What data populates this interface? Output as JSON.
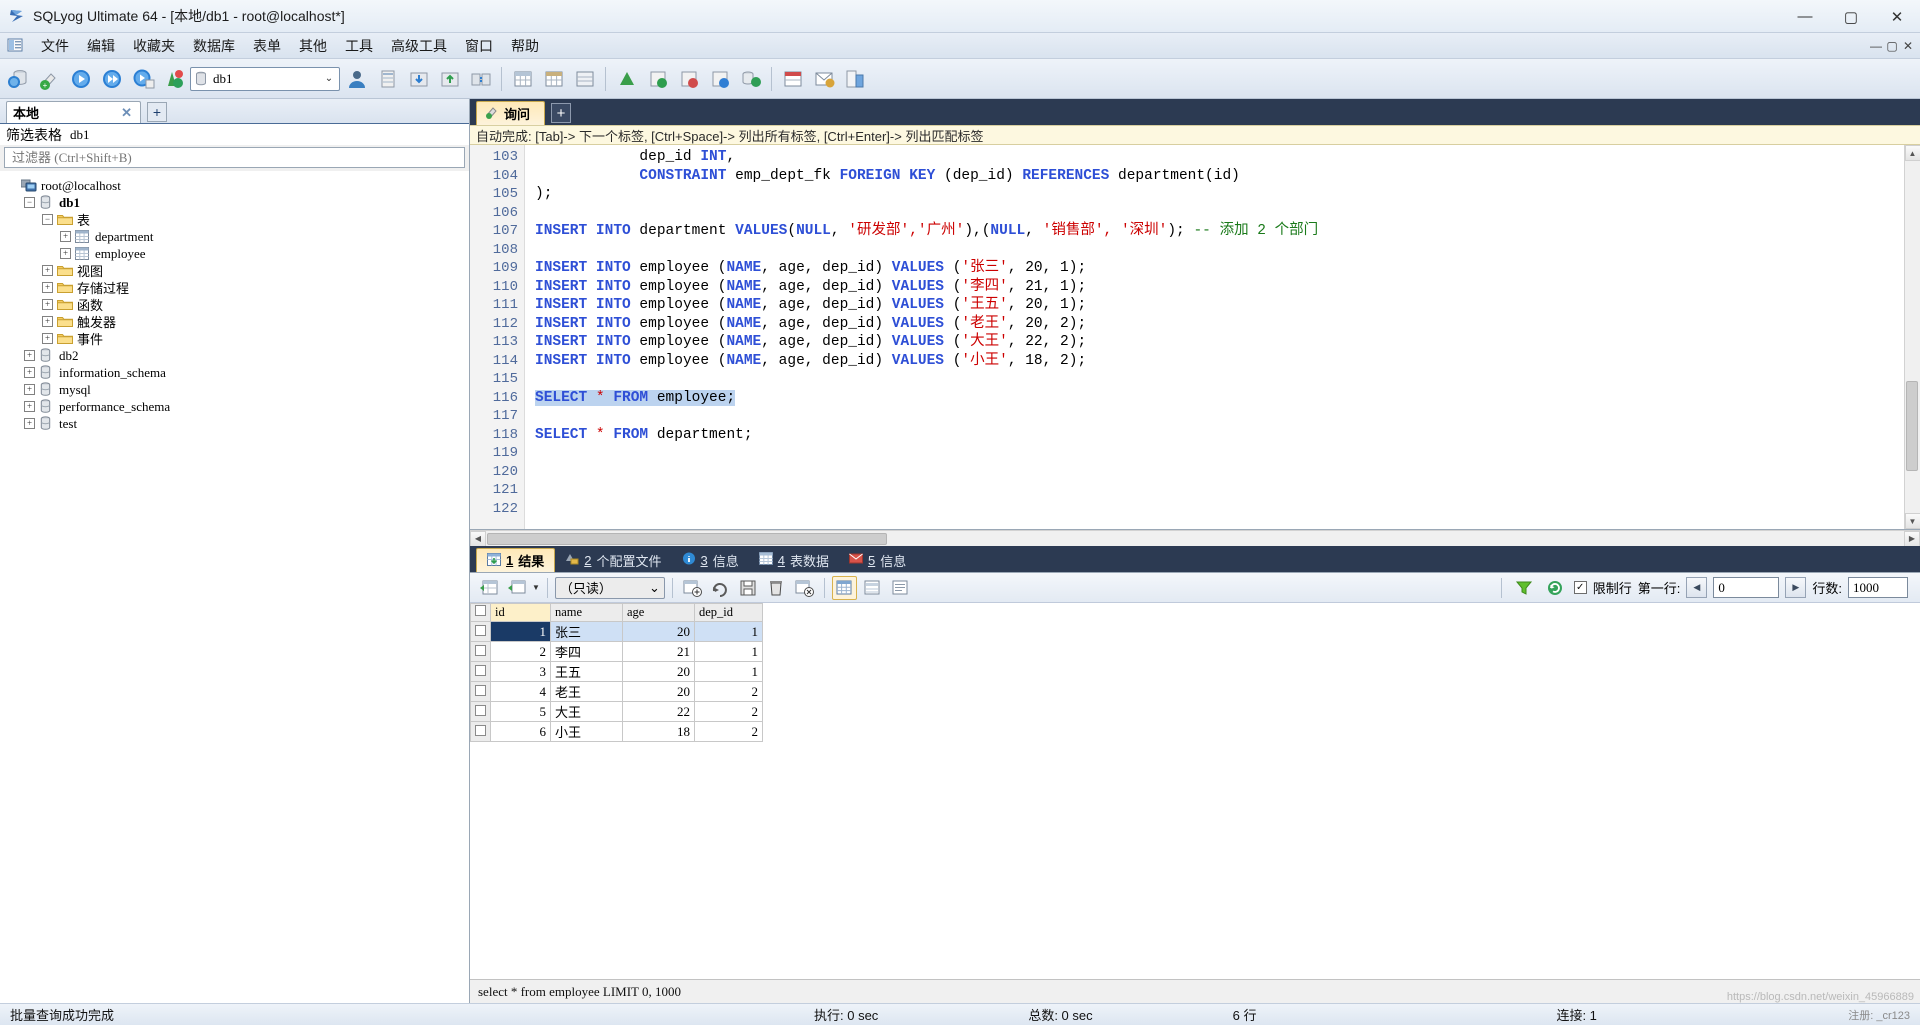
{
  "window": {
    "title": "SQLyog Ultimate 64 - [本地/db1 - root@localhost*]",
    "icon": "sqlyog-logo-icon",
    "controls": {
      "minimize": "—",
      "maximize": "▢",
      "close": "✕"
    }
  },
  "menubar": {
    "items": [
      "文件",
      "编辑",
      "收藏夹",
      "数据库",
      "表单",
      "其他",
      "工具",
      "高级工具",
      "窗口",
      "帮助"
    ],
    "right_buttons": [
      "—",
      "▢",
      "✕"
    ]
  },
  "toolbar": {
    "database_selector": {
      "value": "db1",
      "icon": "database-icon",
      "arrow": "⌄"
    }
  },
  "left_panel": {
    "connection_tab": {
      "label": "本地",
      "close": "✕"
    },
    "add_tab_label": "+",
    "filter_header": {
      "label": "筛选表格",
      "db": "db1"
    },
    "filter_input": {
      "value": "",
      "placeholder": "过滤器 (Ctrl+Shift+B)"
    },
    "tree": [
      {
        "label": "root@localhost",
        "icon": "host-icon",
        "depth": 0,
        "expander": "",
        "bold": false,
        "cn": false
      },
      {
        "label": "db1",
        "icon": "database-icon",
        "depth": 1,
        "expander": "−",
        "bold": true,
        "cn": false
      },
      {
        "label": "表",
        "icon": "folder-icon",
        "depth": 2,
        "expander": "−",
        "bold": false,
        "cn": true
      },
      {
        "label": "department",
        "icon": "table-icon",
        "depth": 3,
        "expander": "+",
        "bold": false,
        "cn": false
      },
      {
        "label": "employee",
        "icon": "table-icon",
        "depth": 3,
        "expander": "+",
        "bold": false,
        "cn": false
      },
      {
        "label": "视图",
        "icon": "folder-icon",
        "depth": 2,
        "expander": "+",
        "bold": false,
        "cn": true
      },
      {
        "label": "存储过程",
        "icon": "folder-icon",
        "depth": 2,
        "expander": "+",
        "bold": false,
        "cn": true
      },
      {
        "label": "函数",
        "icon": "folder-icon",
        "depth": 2,
        "expander": "+",
        "bold": false,
        "cn": true
      },
      {
        "label": "触发器",
        "icon": "folder-icon",
        "depth": 2,
        "expander": "+",
        "bold": false,
        "cn": true
      },
      {
        "label": "事件",
        "icon": "folder-icon",
        "depth": 2,
        "expander": "+",
        "bold": false,
        "cn": true
      },
      {
        "label": "db2",
        "icon": "database-icon",
        "depth": 1,
        "expander": "+",
        "bold": false,
        "cn": false
      },
      {
        "label": "information_schema",
        "icon": "database-icon",
        "depth": 1,
        "expander": "+",
        "bold": false,
        "cn": false
      },
      {
        "label": "mysql",
        "icon": "database-icon",
        "depth": 1,
        "expander": "+",
        "bold": false,
        "cn": false
      },
      {
        "label": "performance_schema",
        "icon": "database-icon",
        "depth": 1,
        "expander": "+",
        "bold": false,
        "cn": false
      },
      {
        "label": "test",
        "icon": "database-icon",
        "depth": 1,
        "expander": "+",
        "bold": false,
        "cn": false
      }
    ]
  },
  "editor": {
    "tab": {
      "label": "询问",
      "icon": "query-icon"
    },
    "add_tab_label": "+",
    "hint": "自动完成: [Tab]-> 下一个标签, [Ctrl+Space]-> 列出所有标签, [Ctrl+Enter]-> 列出匹配标签",
    "first_line_number": 103,
    "lines": [
      {
        "n": 103,
        "segments": [
          {
            "t": "            dep_id ",
            "c": "plain"
          },
          {
            "t": "INT",
            "c": "kw"
          },
          {
            "t": ",",
            "c": "plain"
          }
        ]
      },
      {
        "n": 104,
        "segments": [
          {
            "t": "            ",
            "c": "plain"
          },
          {
            "t": "CONSTRAINT",
            "c": "kw"
          },
          {
            "t": " emp_dept_fk ",
            "c": "plain"
          },
          {
            "t": "FOREIGN",
            "c": "kw"
          },
          {
            "t": " ",
            "c": "plain"
          },
          {
            "t": "KEY",
            "c": "kw"
          },
          {
            "t": " (dep_id) ",
            "c": "plain"
          },
          {
            "t": "REFERENCES",
            "c": "kw"
          },
          {
            "t": " department(id)",
            "c": "plain"
          }
        ]
      },
      {
        "n": 105,
        "segments": [
          {
            "t": ");",
            "c": "plain"
          }
        ]
      },
      {
        "n": 106,
        "segments": [
          {
            "t": "",
            "c": "plain"
          }
        ]
      },
      {
        "n": 107,
        "segments": [
          {
            "t": "INSERT",
            "c": "kw"
          },
          {
            "t": " ",
            "c": "plain"
          },
          {
            "t": "INTO",
            "c": "kw"
          },
          {
            "t": " department ",
            "c": "plain"
          },
          {
            "t": "VALUES",
            "c": "kw"
          },
          {
            "t": "(",
            "c": "plain"
          },
          {
            "t": "NULL",
            "c": "kw"
          },
          {
            "t": ", ",
            "c": "plain"
          },
          {
            "t": "'研发部','广州'",
            "c": "str"
          },
          {
            "t": "),(",
            "c": "plain"
          },
          {
            "t": "NULL",
            "c": "kw"
          },
          {
            "t": ", ",
            "c": "plain"
          },
          {
            "t": "'销售部', '深圳'",
            "c": "str"
          },
          {
            "t": "); ",
            "c": "plain"
          },
          {
            "t": "-- 添加 2 个部门",
            "c": "cmt"
          }
        ]
      },
      {
        "n": 108,
        "segments": [
          {
            "t": "",
            "c": "plain"
          }
        ]
      },
      {
        "n": 109,
        "segments": [
          {
            "t": "INSERT",
            "c": "kw"
          },
          {
            "t": " ",
            "c": "plain"
          },
          {
            "t": "INTO",
            "c": "kw"
          },
          {
            "t": " employee (",
            "c": "plain"
          },
          {
            "t": "NAME",
            "c": "kw"
          },
          {
            "t": ", age, dep_id) ",
            "c": "plain"
          },
          {
            "t": "VALUES",
            "c": "kw"
          },
          {
            "t": " (",
            "c": "plain"
          },
          {
            "t": "'张三'",
            "c": "str"
          },
          {
            "t": ", 20, 1);",
            "c": "plain"
          }
        ]
      },
      {
        "n": 110,
        "segments": [
          {
            "t": "INSERT",
            "c": "kw"
          },
          {
            "t": " ",
            "c": "plain"
          },
          {
            "t": "INTO",
            "c": "kw"
          },
          {
            "t": " employee (",
            "c": "plain"
          },
          {
            "t": "NAME",
            "c": "kw"
          },
          {
            "t": ", age, dep_id) ",
            "c": "plain"
          },
          {
            "t": "VALUES",
            "c": "kw"
          },
          {
            "t": " (",
            "c": "plain"
          },
          {
            "t": "'李四'",
            "c": "str"
          },
          {
            "t": ", 21, 1);",
            "c": "plain"
          }
        ]
      },
      {
        "n": 111,
        "segments": [
          {
            "t": "INSERT",
            "c": "kw"
          },
          {
            "t": " ",
            "c": "plain"
          },
          {
            "t": "INTO",
            "c": "kw"
          },
          {
            "t": " employee (",
            "c": "plain"
          },
          {
            "t": "NAME",
            "c": "kw"
          },
          {
            "t": ", age, dep_id) ",
            "c": "plain"
          },
          {
            "t": "VALUES",
            "c": "kw"
          },
          {
            "t": " (",
            "c": "plain"
          },
          {
            "t": "'王五'",
            "c": "str"
          },
          {
            "t": ", 20, 1);",
            "c": "plain"
          }
        ]
      },
      {
        "n": 112,
        "segments": [
          {
            "t": "INSERT",
            "c": "kw"
          },
          {
            "t": " ",
            "c": "plain"
          },
          {
            "t": "INTO",
            "c": "kw"
          },
          {
            "t": " employee (",
            "c": "plain"
          },
          {
            "t": "NAME",
            "c": "kw"
          },
          {
            "t": ", age, dep_id) ",
            "c": "plain"
          },
          {
            "t": "VALUES",
            "c": "kw"
          },
          {
            "t": " (",
            "c": "plain"
          },
          {
            "t": "'老王'",
            "c": "str"
          },
          {
            "t": ", 20, 2);",
            "c": "plain"
          }
        ]
      },
      {
        "n": 113,
        "segments": [
          {
            "t": "INSERT",
            "c": "kw"
          },
          {
            "t": " ",
            "c": "plain"
          },
          {
            "t": "INTO",
            "c": "kw"
          },
          {
            "t": " employee (",
            "c": "plain"
          },
          {
            "t": "NAME",
            "c": "kw"
          },
          {
            "t": ", age, dep_id) ",
            "c": "plain"
          },
          {
            "t": "VALUES",
            "c": "kw"
          },
          {
            "t": " (",
            "c": "plain"
          },
          {
            "t": "'大王'",
            "c": "str"
          },
          {
            "t": ", 22, 2);",
            "c": "plain"
          }
        ]
      },
      {
        "n": 114,
        "segments": [
          {
            "t": "INSERT",
            "c": "kw"
          },
          {
            "t": " ",
            "c": "plain"
          },
          {
            "t": "INTO",
            "c": "kw"
          },
          {
            "t": " employee (",
            "c": "plain"
          },
          {
            "t": "NAME",
            "c": "kw"
          },
          {
            "t": ", age, dep_id) ",
            "c": "plain"
          },
          {
            "t": "VALUES",
            "c": "kw"
          },
          {
            "t": " (",
            "c": "plain"
          },
          {
            "t": "'小王'",
            "c": "str"
          },
          {
            "t": ", 18, 2);",
            "c": "plain"
          }
        ]
      },
      {
        "n": 115,
        "segments": [
          {
            "t": "",
            "c": "plain"
          }
        ]
      },
      {
        "n": 116,
        "selected": true,
        "segments": [
          {
            "t": "SELECT",
            "c": "kw"
          },
          {
            "t": " ",
            "c": "plain"
          },
          {
            "t": "*",
            "c": "str"
          },
          {
            "t": " ",
            "c": "plain"
          },
          {
            "t": "FROM",
            "c": "kw"
          },
          {
            "t": " employee;",
            "c": "plain"
          }
        ]
      },
      {
        "n": 117,
        "segments": [
          {
            "t": "",
            "c": "plain"
          }
        ]
      },
      {
        "n": 118,
        "segments": [
          {
            "t": "SELECT",
            "c": "kw"
          },
          {
            "t": " ",
            "c": "plain"
          },
          {
            "t": "*",
            "c": "str"
          },
          {
            "t": " ",
            "c": "plain"
          },
          {
            "t": "FROM",
            "c": "kw"
          },
          {
            "t": " department;",
            "c": "plain"
          }
        ]
      },
      {
        "n": 119,
        "segments": [
          {
            "t": "",
            "c": "plain"
          }
        ]
      },
      {
        "n": 120,
        "segments": [
          {
            "t": "",
            "c": "plain"
          }
        ]
      },
      {
        "n": 121,
        "segments": [
          {
            "t": "",
            "c": "plain"
          }
        ]
      },
      {
        "n": 122,
        "segments": [
          {
            "t": "",
            "c": "plain"
          }
        ]
      }
    ]
  },
  "result_tabs": [
    {
      "num": "1",
      "label": "结果",
      "icon": "result-grid-icon",
      "active": true
    },
    {
      "num": "2",
      "label": "个配置文件",
      "icon": "profile-icon",
      "active": false
    },
    {
      "num": "3",
      "label": "信息",
      "icon": "info-icon",
      "active": false
    },
    {
      "num": "4",
      "label": "表数据",
      "icon": "table-data-icon",
      "active": false
    },
    {
      "num": "5",
      "label": "信息",
      "icon": "messages-icon",
      "active": false
    }
  ],
  "grid_toolbar": {
    "mode_select": {
      "value": "（只读）",
      "arrow": "⌄"
    },
    "limit_rows_label": "限制行",
    "limit_rows_checked": true,
    "first_row_label": "第一行:",
    "first_row_value": "0",
    "row_count_label": "行数:",
    "row_count_value": "1000",
    "prev_arrow": "◀",
    "next_arrow": "▶",
    "icons": [
      "insert-row-icon",
      "insert-row-dropdown-icon",
      "add-record-icon",
      "refresh-record-icon",
      "save-record-icon",
      "delete-record-icon",
      "cancel-record-icon",
      "grid-view-icon",
      "form-view-icon",
      "text-view-icon",
      "filter-icon",
      "refresh-icon"
    ]
  },
  "result_grid": {
    "columns": [
      "id",
      "name",
      "age",
      "dep_id"
    ],
    "key_column": "id",
    "rows": [
      {
        "id": "1",
        "name": "张三",
        "age": "20",
        "dep_id": "1"
      },
      {
        "id": "2",
        "name": "李四",
        "age": "21",
        "dep_id": "1"
      },
      {
        "id": "3",
        "name": "王五",
        "age": "20",
        "dep_id": "1"
      },
      {
        "id": "4",
        "name": "老王",
        "age": "20",
        "dep_id": "2"
      },
      {
        "id": "5",
        "name": "大王",
        "age": "22",
        "dep_id": "2"
      },
      {
        "id": "6",
        "name": "小王",
        "age": "18",
        "dep_id": "2"
      }
    ]
  },
  "executed_sql": "select * from employee LIMIT 0, 1000",
  "statusbar": {
    "message": "批量查询成功完成",
    "exec_time": "执行: 0 sec",
    "total_time": "总数: 0 sec",
    "row_count": "6 行",
    "connections": "连接: 1"
  },
  "watermarks": {
    "top": "https://blog.csdn.net/weixin_45966889",
    "bottom": "注册: _cr123"
  }
}
